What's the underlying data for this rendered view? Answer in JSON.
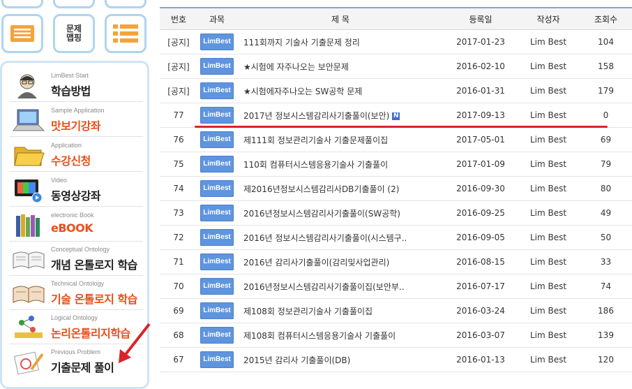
{
  "sidebar": {
    "top_buttons": [
      {
        "name": "list-icon-button",
        "label": ""
      },
      {
        "name": "mapping-button",
        "label": "문제\n맵핑"
      },
      {
        "name": "menu-list-button",
        "label": ""
      }
    ],
    "items": [
      {
        "sub": "LimBest Start",
        "main": "학습방법",
        "color": "#222222",
        "icon": "student-icon"
      },
      {
        "sub": "Sample Application",
        "main": "맛보기강좌",
        "color": "#e8501b",
        "icon": "laptop-icon"
      },
      {
        "sub": "Application",
        "main": "수강신청",
        "color": "#e8501b",
        "icon": "folder-icon"
      },
      {
        "sub": "Video",
        "main": "동영상강좌",
        "color": "#222222",
        "icon": "video-monitor-icon"
      },
      {
        "sub": "electronic Book",
        "main": "eBOOK",
        "color": "#e8501b",
        "icon": "books-icon"
      },
      {
        "sub": "Conceptual Ontology",
        "main": "개념 온톨로지 학습",
        "color": "#222222",
        "icon": "open-book-icon"
      },
      {
        "sub": "Technical Ontology",
        "main": "기술 온톨로지 학습",
        "color": "#e8501b",
        "icon": "open-book-brown-icon"
      },
      {
        "sub": "Logical Ontology",
        "main": "논리온톨리지학습",
        "color": "#e8501b",
        "icon": "molecule-icon"
      },
      {
        "sub": "Previous Problem",
        "main": "기출문제 풀이",
        "color": "#222222",
        "icon": "pencil-paper-icon"
      }
    ]
  },
  "board": {
    "headers": [
      "번호",
      "과목",
      "제 목",
      "등록일",
      "작성자",
      "조회수"
    ],
    "badge_label": "LimBest",
    "new_badge": "N",
    "rows": [
      {
        "no": "[공지]",
        "title": "111회까지 기술사 기출문제 정리",
        "date": "2017-01-23",
        "author": "Lim Best",
        "views": "104",
        "new": false
      },
      {
        "no": "[공지]",
        "title": "★시험에 자주나오는 보안문제",
        "date": "2016-02-10",
        "author": "Lim Best",
        "views": "158",
        "new": false
      },
      {
        "no": "[공지]",
        "title": "★시험에자주나오는 SW공학 문제",
        "date": "2016-01-31",
        "author": "Lim Best",
        "views": "179",
        "new": false
      },
      {
        "no": "77",
        "title": "2017년 정보시스템감리사기출풀이(보안)",
        "date": "2017-09-13",
        "author": "Lim Best",
        "views": "0",
        "new": true
      },
      {
        "no": "76",
        "title": "제111회 정보관리기술사 기출문제풀이집",
        "date": "2017-05-01",
        "author": "Lim Best",
        "views": "69",
        "new": false
      },
      {
        "no": "75",
        "title": "110회 컴퓨터시스템응용기술사 기출풀이",
        "date": "2017-01-09",
        "author": "Lim Best",
        "views": "79",
        "new": false
      },
      {
        "no": "74",
        "title": "제2016년정보시스템감리사DB기출풀이 (2)",
        "date": "2016-09-30",
        "author": "Lim Best",
        "views": "80",
        "new": false
      },
      {
        "no": "73",
        "title": "2016년정보시스템감리사기출풀이(SW공학)",
        "date": "2016-09-25",
        "author": "Lim Best",
        "views": "49",
        "new": false
      },
      {
        "no": "72",
        "title": "2016년 정보시스템감리사기출풀이(시스템구..",
        "date": "2016-09-05",
        "author": "Lim Best",
        "views": "50",
        "new": false
      },
      {
        "no": "71",
        "title": "2016년 감리사기출풀이(감리및사업관리)",
        "date": "2016-08-15",
        "author": "Lim Best",
        "views": "33",
        "new": false
      },
      {
        "no": "70",
        "title": "2016년정보시스템감리사기출풀이집(보안부..",
        "date": "2016-07-17",
        "author": "Lim Best",
        "views": "74",
        "new": false
      },
      {
        "no": "69",
        "title": "제108회 정보관리기술사 기출풀이집",
        "date": "2016-03-24",
        "author": "Lim Best",
        "views": "186",
        "new": false
      },
      {
        "no": "68",
        "title": "제108회 컴퓨터시스템응용기술사 기출풀이",
        "date": "2016-03-07",
        "author": "Lim Best",
        "views": "139",
        "new": false
      },
      {
        "no": "67",
        "title": "2015년 감리사 기출풀이(DB)",
        "date": "2016-01-13",
        "author": "Lim Best",
        "views": "120",
        "new": false
      }
    ]
  },
  "colors": {
    "accent_blue": "#5f94df",
    "highlight_red": "#d9242a",
    "orange": "#f5a33a"
  }
}
